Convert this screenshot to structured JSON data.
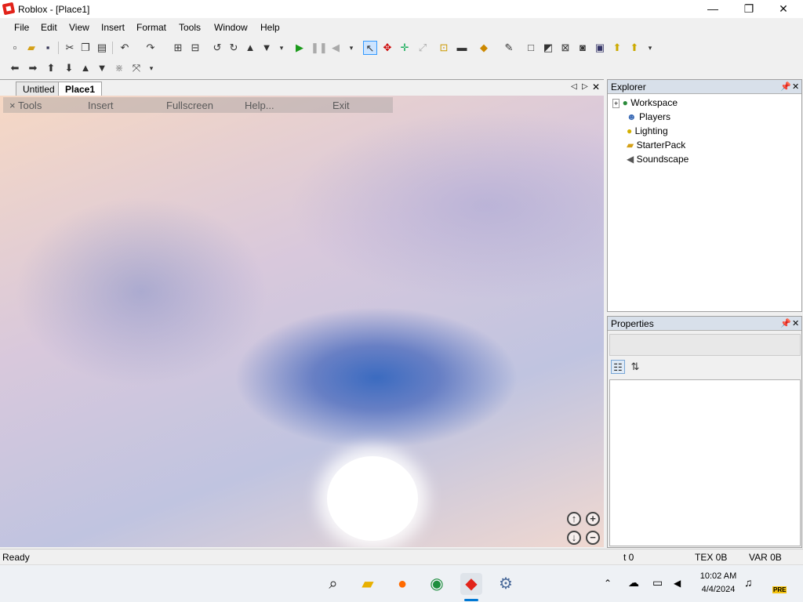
{
  "window": {
    "title": "Roblox - [Place1]",
    "minimize": "—",
    "maximize": "❐",
    "close": "✕"
  },
  "menu": [
    "File",
    "Edit",
    "View",
    "Insert",
    "Format",
    "Tools",
    "Window",
    "Help"
  ],
  "tabs": {
    "untitled": "Untitled",
    "place1": "Place1"
  },
  "game_menu": {
    "tools": "Tools",
    "insert": "Insert",
    "fullscreen": "Fullscreen",
    "help": "Help...",
    "exit": "Exit"
  },
  "explorer": {
    "title": "Explorer",
    "items": [
      "Workspace",
      "Players",
      "Lighting",
      "StarterPack",
      "Soundscape"
    ]
  },
  "properties": {
    "title": "Properties"
  },
  "status": {
    "left": "Ready",
    "t": "t 0",
    "tex": "TEX 0B",
    "var": "VAR 0B"
  },
  "tray": {
    "time": "10:02 AM",
    "date": "4/4/2024",
    "badge": "PRE"
  },
  "colors": {
    "accent": "#0078d4",
    "viewport_sky": "#3b6bc0",
    "panel_header": "#d8e0ea"
  }
}
